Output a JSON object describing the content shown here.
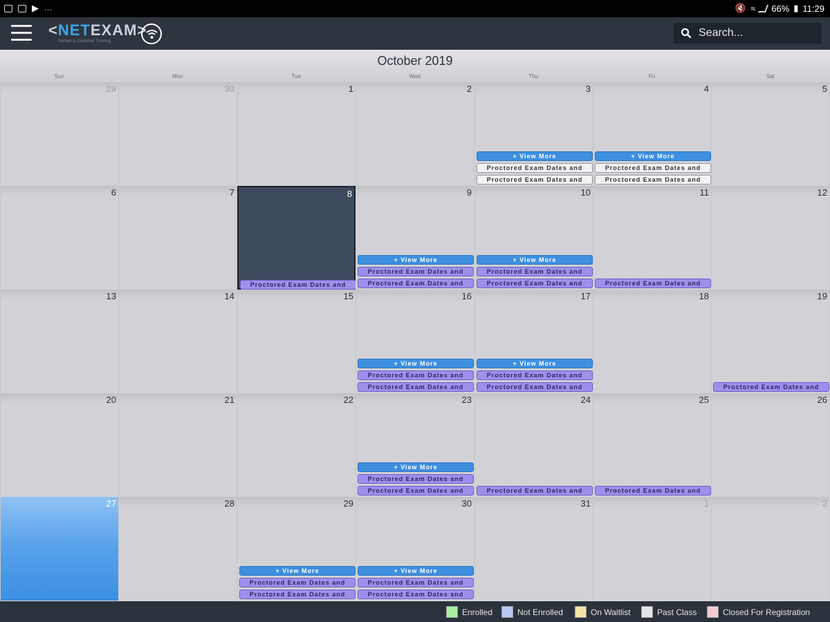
{
  "status": {
    "left_icons": [
      "eye-icon",
      "image-icon",
      "play-icon"
    ],
    "dots": "...",
    "right_text": "66%",
    "time": "11:29"
  },
  "app": {
    "logo_main": "NET",
    "logo_accent": "EXAM",
    "logo_tagline": "Partner & Customer Training",
    "search_placeholder": "Search..."
  },
  "calendar": {
    "title": "October 2019",
    "weekdays": [
      "Sun",
      "Mon",
      "Tue",
      "Wed",
      "Thu",
      "Fri",
      "Sat"
    ],
    "view_more_label": "+ View More",
    "event_title": "Proctored Exam Dates and",
    "weeks": [
      [
        {
          "d": "29",
          "o": true,
          "e": []
        },
        {
          "d": "30",
          "o": true,
          "e": []
        },
        {
          "d": "1",
          "e": []
        },
        {
          "d": "2",
          "e": []
        },
        {
          "d": "3",
          "e": [
            "vm",
            "pc",
            "pc"
          ]
        },
        {
          "d": "4",
          "e": [
            "vm",
            "pc",
            "pc"
          ]
        },
        {
          "d": "5",
          "e": []
        }
      ],
      [
        {
          "d": "6",
          "e": []
        },
        {
          "d": "7",
          "e": []
        },
        {
          "d": "8",
          "s": true,
          "e": [
            "ne"
          ]
        },
        {
          "d": "9",
          "e": [
            "vm",
            "ne",
            "ne"
          ]
        },
        {
          "d": "10",
          "e": [
            "vm",
            "ne",
            "ne"
          ]
        },
        {
          "d": "11",
          "e": [
            "ne"
          ]
        },
        {
          "d": "12",
          "e": []
        }
      ],
      [
        {
          "d": "13",
          "e": []
        },
        {
          "d": "14",
          "e": []
        },
        {
          "d": "15",
          "e": []
        },
        {
          "d": "16",
          "e": [
            "vm",
            "ne",
            "ne"
          ]
        },
        {
          "d": "17",
          "e": [
            "vm",
            "ne",
            "ne"
          ]
        },
        {
          "d": "18",
          "e": []
        },
        {
          "d": "19",
          "e": [
            "ne"
          ]
        }
      ],
      [
        {
          "d": "20",
          "e": []
        },
        {
          "d": "21",
          "e": []
        },
        {
          "d": "22",
          "e": []
        },
        {
          "d": "23",
          "e": [
            "vm",
            "ne",
            "ne"
          ]
        },
        {
          "d": "24",
          "e": [
            "ne"
          ]
        },
        {
          "d": "25",
          "e": [
            "ne"
          ]
        },
        {
          "d": "26",
          "e": []
        }
      ],
      [
        {
          "d": "27",
          "t": true,
          "e": []
        },
        {
          "d": "28",
          "e": []
        },
        {
          "d": "29",
          "e": [
            "vm",
            "ne",
            "ne"
          ]
        },
        {
          "d": "30",
          "e": [
            "vm",
            "ne",
            "ne"
          ]
        },
        {
          "d": "31",
          "e": []
        },
        {
          "d": "1",
          "o": true,
          "e": []
        },
        {
          "d": "2",
          "o": true,
          "e": []
        }
      ]
    ]
  },
  "legend": [
    {
      "label": "Enrolled",
      "color": "#a8f0a0"
    },
    {
      "label": "Not Enrolled",
      "color": "#b9c8f5"
    },
    {
      "label": "On Waitlist",
      "color": "#f5e4a6"
    },
    {
      "label": "Past Class",
      "color": "#e4e4e6"
    },
    {
      "label": "Closed For Registration",
      "color": "#f6c9d6"
    }
  ]
}
